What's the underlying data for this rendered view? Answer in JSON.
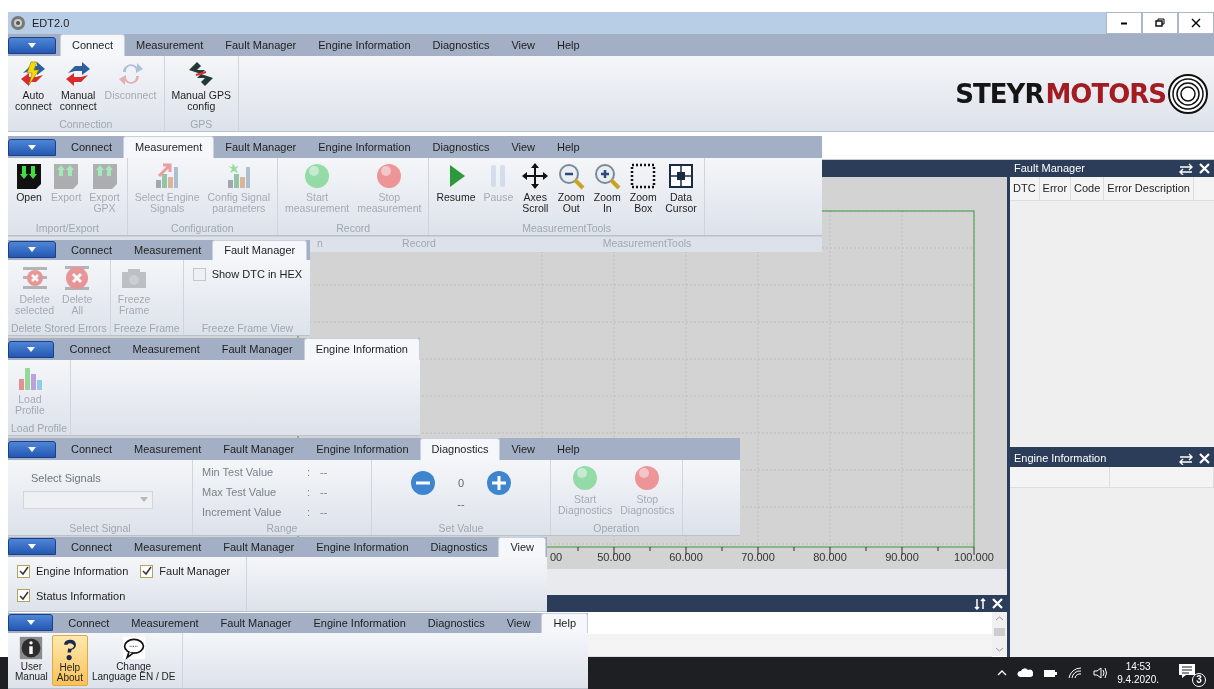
{
  "window": {
    "title": "EDT2.0"
  },
  "ribbons": [
    {
      "tabs": [
        {
          "label": "Connect",
          "selected": true
        },
        {
          "label": "Measurement",
          "selected": false
        },
        {
          "label": "Fault Manager",
          "selected": false
        },
        {
          "label": "Engine Information",
          "selected": false
        },
        {
          "label": "Diagnostics",
          "selected": false
        },
        {
          "label": "View",
          "selected": false
        },
        {
          "label": "Help",
          "selected": false
        }
      ],
      "groups": [
        {
          "label": "Connection",
          "items": [
            {
              "kind": "button",
              "label": "Auto\nconnect",
              "disabled": false
            },
            {
              "kind": "button",
              "label": "Manual\nconnect",
              "disabled": false
            },
            {
              "kind": "button",
              "label": "Disconnect",
              "disabled": true
            }
          ]
        },
        {
          "label": "GPS",
          "items": [
            {
              "kind": "button",
              "label": "Manual GPS\nconfig",
              "disabled": false
            }
          ]
        }
      ],
      "logo": {
        "first": "STEYR",
        "second": "MOTORS"
      }
    },
    {
      "tabs": [
        {
          "label": "Connect",
          "selected": false
        },
        {
          "label": "Measurement",
          "selected": true
        },
        {
          "label": "Fault Manager",
          "selected": false
        },
        {
          "label": "Engine Information",
          "selected": false
        },
        {
          "label": "Diagnostics",
          "selected": false
        },
        {
          "label": "View",
          "selected": false
        },
        {
          "label": "Help",
          "selected": false
        }
      ],
      "groups": [
        {
          "label": "Import/Export",
          "items": [
            {
              "kind": "button",
              "label": "Open",
              "disabled": false
            },
            {
              "kind": "button",
              "label": "Export",
              "disabled": true
            },
            {
              "kind": "button",
              "label": "Export\nGPX",
              "disabled": true
            }
          ]
        },
        {
          "label": "Configuration",
          "items": [
            {
              "kind": "button",
              "label": "Select Engine\nSignals",
              "disabled": true
            },
            {
              "kind": "button",
              "label": "Config Signal\nparameters",
              "disabled": true
            }
          ]
        },
        {
          "label": "Record",
          "items": [
            {
              "kind": "button",
              "label": "Start\nmeasurement",
              "disabled": true
            },
            {
              "kind": "button",
              "label": "Stop\nmeasurement",
              "disabled": true
            }
          ]
        },
        {
          "label": "MeasurementTools",
          "items": [
            {
              "kind": "button",
              "label": "Resume",
              "disabled": false
            },
            {
              "kind": "button",
              "label": "Pause",
              "disabled": true
            },
            {
              "kind": "button",
              "label": "Axes\nScroll",
              "disabled": false
            },
            {
              "kind": "button",
              "label": "Zoom\nOut",
              "disabled": false
            },
            {
              "kind": "button",
              "label": "Zoom\nIn",
              "disabled": false
            },
            {
              "kind": "button",
              "label": "Zoom\nBox",
              "disabled": false
            },
            {
              "kind": "button",
              "label": "Data\nCursor",
              "disabled": false
            }
          ]
        }
      ],
      "footer_labels": [
        "n",
        "Record",
        "MeasurementTools"
      ]
    },
    {
      "tabs": [
        {
          "label": "Connect",
          "selected": false
        },
        {
          "label": "Measurement",
          "selected": false
        },
        {
          "label": "Fault Manager",
          "selected": true
        }
      ],
      "groups": [
        {
          "label": "Delete Stored Errors",
          "items": [
            {
              "kind": "button",
              "label": "Delete\nselected",
              "disabled": true
            },
            {
              "kind": "button",
              "label": "Delete\nAll",
              "disabled": true
            }
          ]
        },
        {
          "label": "Freeze Frame",
          "items": [
            {
              "kind": "button",
              "label": "Freeze\nFrame",
              "disabled": true
            }
          ]
        },
        {
          "label": "Freeze Frame View",
          "items": [
            {
              "kind": "checkbox",
              "label": "Show DTC in HEX",
              "checked": false
            }
          ]
        }
      ]
    },
    {
      "tabs": [
        {
          "label": "Connect",
          "selected": false
        },
        {
          "label": "Measurement",
          "selected": false
        },
        {
          "label": "Fault Manager",
          "selected": false
        },
        {
          "label": "Engine Information",
          "selected": true
        }
      ],
      "groups": [
        {
          "label": "Load Profile",
          "items": [
            {
              "kind": "button",
              "label": "Load\nProfile",
              "disabled": true
            }
          ]
        }
      ]
    },
    {
      "tabs": [
        {
          "label": "Connect",
          "selected": false
        },
        {
          "label": "Measurement",
          "selected": false
        },
        {
          "label": "Fault Manager",
          "selected": false
        },
        {
          "label": "Engine Information",
          "selected": false
        },
        {
          "label": "Diagnostics",
          "selected": true
        },
        {
          "label": "View",
          "selected": false
        },
        {
          "label": "Help",
          "selected": false
        }
      ],
      "groups": [
        {
          "label": "Select Signal",
          "items": [
            {
              "kind": "dropdown",
              "label": "Select Signals",
              "disabled": true
            }
          ]
        },
        {
          "label": "Range",
          "items": [
            {
              "kind": "reading",
              "label": "Min Test Value",
              "separator": ":",
              "value": "--"
            },
            {
              "kind": "reading",
              "label": "Max Test Value",
              "separator": ":",
              "value": "--"
            },
            {
              "kind": "reading",
              "label": "Increment Value",
              "separator": ":",
              "value": "--"
            }
          ]
        },
        {
          "label": "Set Value",
          "items": [
            {
              "kind": "stepper",
              "value": "0",
              "reading": "--"
            }
          ]
        },
        {
          "label": "Operation",
          "items": [
            {
              "kind": "button",
              "label": "Start\nDiagnostics",
              "disabled": true
            },
            {
              "kind": "button",
              "label": "Stop\nDiagnostics",
              "disabled": true
            }
          ]
        }
      ]
    },
    {
      "tabs": [
        {
          "label": "Connect",
          "selected": false
        },
        {
          "label": "Measurement",
          "selected": false
        },
        {
          "label": "Fault Manager",
          "selected": false
        },
        {
          "label": "Engine Information",
          "selected": false
        },
        {
          "label": "Diagnostics",
          "selected": false
        },
        {
          "label": "View",
          "selected": true
        }
      ],
      "groups": [
        {
          "items": [
            {
              "kind": "checkbox",
              "label": "Engine Information",
              "checked": true
            },
            {
              "kind": "checkbox",
              "label": "Fault Manager",
              "checked": true
            },
            {
              "kind": "checkbox",
              "label": "Status Information",
              "checked": true
            }
          ]
        }
      ]
    },
    {
      "tabs": [
        {
          "label": "Connect",
          "selected": false
        },
        {
          "label": "Measurement",
          "selected": false
        },
        {
          "label": "Fault Manager",
          "selected": false
        },
        {
          "label": "Engine Information",
          "selected": false
        },
        {
          "label": "Diagnostics",
          "selected": false
        },
        {
          "label": "View",
          "selected": false
        },
        {
          "label": "Help",
          "selected": true
        }
      ],
      "groups": [
        {
          "items": [
            {
              "kind": "button",
              "label": "User\nManual",
              "disabled": false,
              "highlighted": false
            },
            {
              "kind": "button",
              "label": "Help\nAbout",
              "disabled": false,
              "highlighted": true
            },
            {
              "kind": "button",
              "label": "Change\nLanguage EN / DE",
              "disabled": false,
              "highlighted": false
            }
          ]
        }
      ]
    }
  ],
  "chart_panel": {
    "x_tick_labels": [
      "00",
      "50.000",
      "60.000",
      "70.000",
      "80.000",
      "90.000",
      "100.000"
    ]
  },
  "fault_manager_panel": {
    "title": "Fault Manager",
    "columns": [
      "DTC",
      "Error",
      "Code",
      "Error Description"
    ]
  },
  "engine_info_panel": {
    "title": "Engine Information"
  },
  "taskbar": {
    "time": "14:53",
    "date": "9.4.2020.",
    "notifications": "3"
  }
}
